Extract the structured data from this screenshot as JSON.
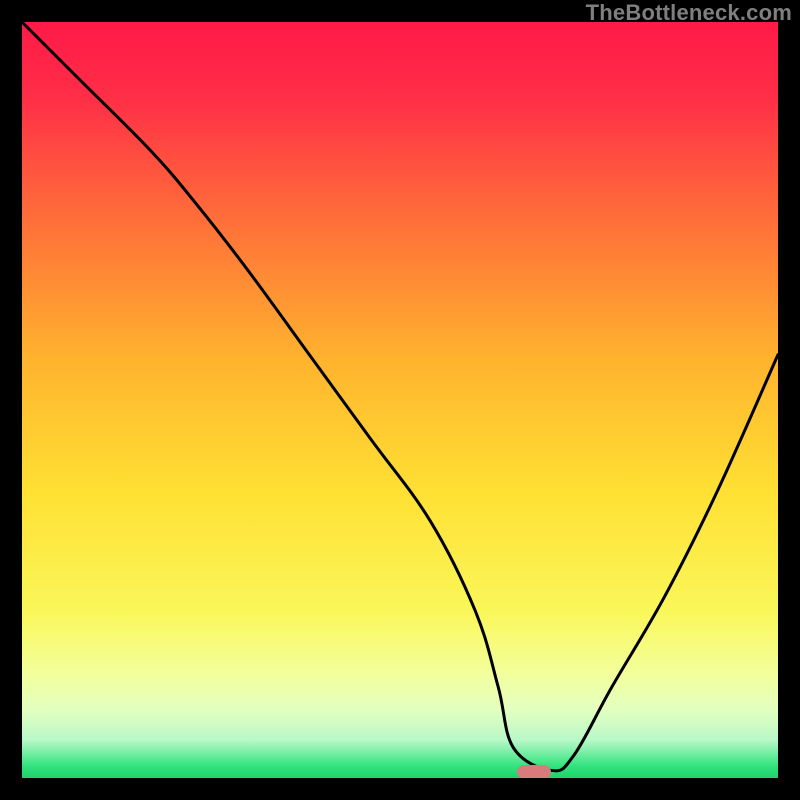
{
  "watermark": "TheBottleneck.com",
  "colors": {
    "gradient_stops": [
      {
        "pos": 0.0,
        "color": "#ff1a47"
      },
      {
        "pos": 0.1,
        "color": "#ff2e47"
      },
      {
        "pos": 0.25,
        "color": "#ff6a3a"
      },
      {
        "pos": 0.45,
        "color": "#ffb42e"
      },
      {
        "pos": 0.62,
        "color": "#ffe033"
      },
      {
        "pos": 0.78,
        "color": "#faf75a"
      },
      {
        "pos": 0.86,
        "color": "#f3ff9a"
      },
      {
        "pos": 0.91,
        "color": "#e3ffc0"
      },
      {
        "pos": 0.95,
        "color": "#b8f8c8"
      },
      {
        "pos": 0.985,
        "color": "#2fe37c"
      },
      {
        "pos": 1.0,
        "color": "#1fd26b"
      }
    ],
    "curve_stroke": "#000000",
    "marker_fill": "#d97b7b",
    "frame": "#000000"
  },
  "marker": {
    "x_pct": 67.7,
    "y_pct": 99.2
  },
  "chart_data": {
    "type": "line",
    "title": "",
    "xlabel": "",
    "ylabel": "",
    "xlim": [
      0,
      100
    ],
    "ylim": [
      0,
      100
    ],
    "series": [
      {
        "name": "bottleneck-curve",
        "x": [
          0,
          8,
          17,
          23,
          30,
          38,
          46,
          54,
          60,
          63,
          65,
          70,
          73,
          78,
          85,
          92,
          100
        ],
        "y": [
          100,
          92,
          83,
          76,
          67,
          56,
          45,
          34,
          22,
          12,
          4,
          1,
          3,
          12,
          24,
          38,
          56
        ]
      }
    ],
    "annotations": [
      {
        "type": "marker",
        "shape": "pill",
        "x": 67.7,
        "y": 0.8
      }
    ],
    "notes": "Background is a vertical red→yellow→green gradient; curve shows distance from optimal (0 = best at green baseline)."
  }
}
